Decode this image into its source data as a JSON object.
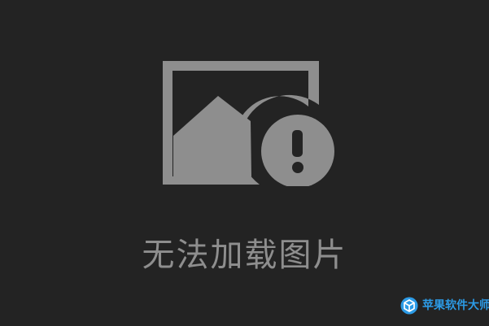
{
  "placeholder": {
    "icon": "broken-image-icon",
    "message": "无法加载图片"
  },
  "watermark": {
    "icon": "cube-logo-icon",
    "text": "苹果软件大师"
  },
  "colors": {
    "background": "#232323",
    "icon": "#8e8e8e",
    "text": "#8e8e8e",
    "watermark": "#2c9be6"
  }
}
